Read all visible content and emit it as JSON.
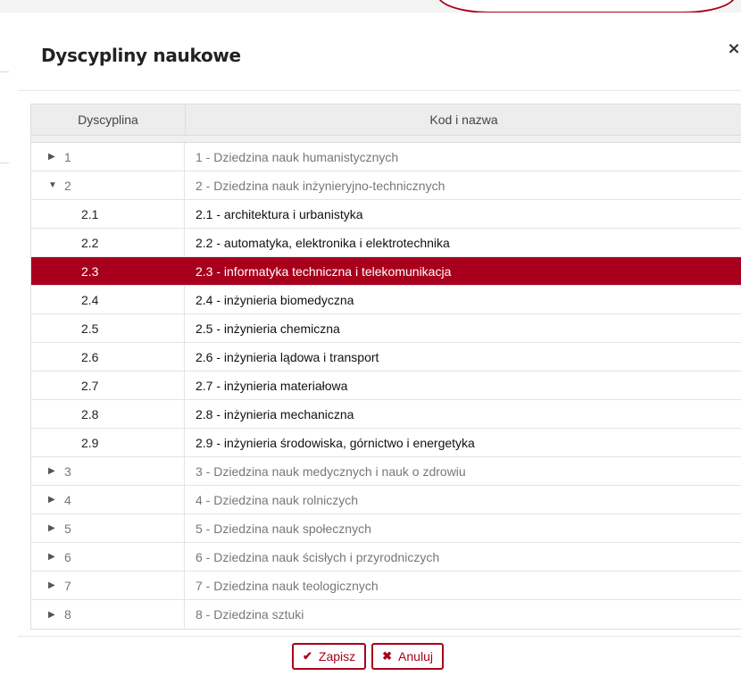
{
  "modal": {
    "title": "Dyscypliny naukowe",
    "close_icon": "×"
  },
  "grid": {
    "columns": [
      "Dyscyplina",
      "Kod i nazwa"
    ],
    "rows": [
      {
        "type": "parent",
        "expanded": false,
        "code": "1",
        "name": "1 - Dziedzina nauk humanistycznych"
      },
      {
        "type": "parent",
        "expanded": true,
        "code": "2",
        "name": "2 - Dziedzina nauk inżynieryjno-technicznych"
      },
      {
        "type": "child",
        "code": "2.1",
        "name": "2.1 - architektura i urbanistyka"
      },
      {
        "type": "child",
        "code": "2.2",
        "name": "2.2 - automatyka, elektronika i elektrotechnika"
      },
      {
        "type": "child",
        "selected": true,
        "code": "2.3",
        "name": "2.3 - informatyka techniczna i telekomunikacja"
      },
      {
        "type": "child",
        "code": "2.4",
        "name": "2.4 - inżynieria biomedyczna"
      },
      {
        "type": "child",
        "code": "2.5",
        "name": "2.5 - inżynieria chemiczna"
      },
      {
        "type": "child",
        "code": "2.6",
        "name": "2.6 - inżynieria lądowa i transport"
      },
      {
        "type": "child",
        "code": "2.7",
        "name": "2.7 - inżynieria materiałowa"
      },
      {
        "type": "child",
        "code": "2.8",
        "name": "2.8 - inżynieria mechaniczna"
      },
      {
        "type": "child",
        "code": "2.9",
        "name": "2.9 - inżynieria środowiska, górnictwo i energetyka"
      },
      {
        "type": "parent",
        "expanded": false,
        "code": "3",
        "name": "3 - Dziedzina nauk medycznych i nauk o zdrowiu"
      },
      {
        "type": "parent",
        "expanded": false,
        "code": "4",
        "name": "4 - Dziedzina nauk rolniczych"
      },
      {
        "type": "parent",
        "expanded": false,
        "code": "5",
        "name": "5 - Dziedzina nauk społecznych"
      },
      {
        "type": "parent",
        "expanded": false,
        "code": "6",
        "name": "6 - Dziedzina nauk ścisłych i przyrodniczych"
      },
      {
        "type": "parent",
        "expanded": false,
        "code": "7",
        "name": "7 - Dziedzina nauk teologicznych"
      },
      {
        "type": "parent",
        "expanded": false,
        "code": "8",
        "name": "8 - Dziedzina sztuki"
      }
    ]
  },
  "footer": {
    "save_label": "Zapisz",
    "save_icon": "check-icon",
    "cancel_label": "Anuluj",
    "cancel_icon": "times-icon"
  },
  "colors": {
    "accent": "#a8001c"
  }
}
